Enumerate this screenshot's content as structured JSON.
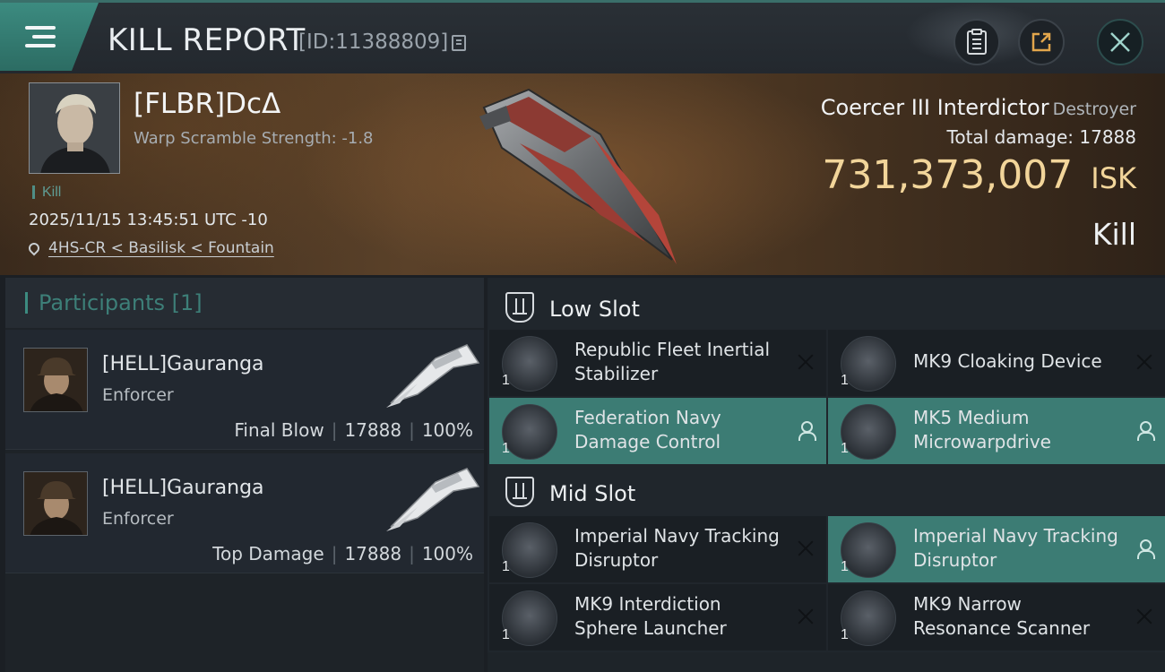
{
  "header": {
    "title": "KILL REPORT",
    "report_id": "[ID:11388809]"
  },
  "victim": {
    "name": "[FLBR]DcΔ",
    "warp_scramble": "Warp Scramble Strength: -1.8",
    "tag": "Kill",
    "timestamp": "2025/11/15 13:45:51 UTC -10",
    "location": "4HS-CR < Basilisk < Fountain"
  },
  "ship": {
    "name": "Coercer III Interdictor",
    "class": "Destroyer",
    "total_damage_label": "Total damage:",
    "total_damage": "17888",
    "isk_value": "731,373,007",
    "isk_unit": "ISK",
    "result": "Kill"
  },
  "participants": {
    "label": "Participants",
    "count": "[1]",
    "rows": [
      {
        "name": "[HELL]Gauranga",
        "ship": "Enforcer",
        "role": "Final Blow",
        "damage": "17888",
        "percent": "100%"
      },
      {
        "name": "[HELL]Gauranga",
        "ship": "Enforcer",
        "role": "Top Damage",
        "damage": "17888",
        "percent": "100%"
      }
    ]
  },
  "fitting": {
    "low_slot": {
      "title": "Low Slot",
      "modules": [
        {
          "name": "Republic Fleet Inertial Stabilizer",
          "qty": "1",
          "status": "destroyed",
          "icon": "inertial-stabilizer-icon"
        },
        {
          "name": "MK9 Cloaking Device",
          "qty": "1",
          "status": "destroyed",
          "icon": "cloaking-device-icon"
        },
        {
          "name": "Federation Navy Damage Control",
          "qty": "1",
          "status": "dropped",
          "icon": "damage-control-icon"
        },
        {
          "name": "MK5 Medium Microwarpdrive",
          "qty": "1",
          "status": "dropped",
          "icon": "microwarpdrive-icon"
        }
      ]
    },
    "mid_slot": {
      "title": "Mid Slot",
      "modules": [
        {
          "name": "Imperial Navy Tracking Disruptor",
          "qty": "1",
          "status": "destroyed",
          "icon": "tracking-disruptor-icon"
        },
        {
          "name": "Imperial Navy Tracking Disruptor",
          "qty": "1",
          "status": "dropped",
          "icon": "tracking-disruptor-icon"
        },
        {
          "name": "MK9 Interdiction Sphere Launcher",
          "qty": "1",
          "status": "destroyed",
          "icon": "sphere-launcher-icon"
        },
        {
          "name": "MK9 Narrow Resonance Scanner",
          "qty": "1",
          "status": "destroyed",
          "icon": "resonance-scanner-icon"
        }
      ]
    }
  },
  "colors": {
    "accent_teal": "#3c8b80",
    "highlight_row": "#3c7c74",
    "isk_gold": "#f2d59a"
  }
}
